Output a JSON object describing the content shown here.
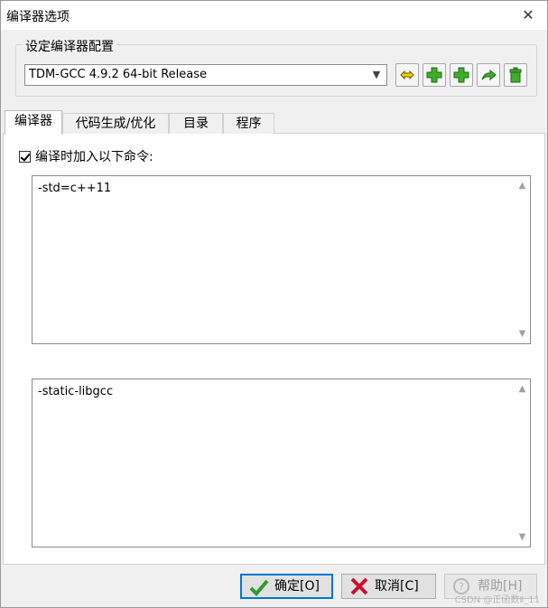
{
  "window": {
    "title": "编译器选项",
    "close_glyph": "✕"
  },
  "config": {
    "group_label": "设定编译器配置",
    "selected_compiler": "TDM-GCC 4.9.2 64-bit Release",
    "toolbar_icons": [
      "rename-icon",
      "add-icon",
      "add-copy-icon",
      "export-icon",
      "delete-icon"
    ]
  },
  "tabs": [
    {
      "label": "编译器",
      "active": true
    },
    {
      "label": "代码生成/优化",
      "active": false
    },
    {
      "label": "目录",
      "active": false
    },
    {
      "label": "程序",
      "active": false
    }
  ],
  "compiler_page": {
    "checkbox_label": "编译时加入以下命令:",
    "checkbox_checked": true,
    "compile_commands": "-std=c++11",
    "linker_commands": "-static-libgcc"
  },
  "buttons": {
    "ok": "确定[O]",
    "cancel": "取消[C]",
    "help": "帮助[H]"
  },
  "watermark": "CSDN @正函数Ⅱ_11",
  "colors": {
    "accent": "#0078d7",
    "green_icon": "#3fae2a",
    "ok_check": "#2e9b2e",
    "cancel_x": "#c8102e"
  }
}
